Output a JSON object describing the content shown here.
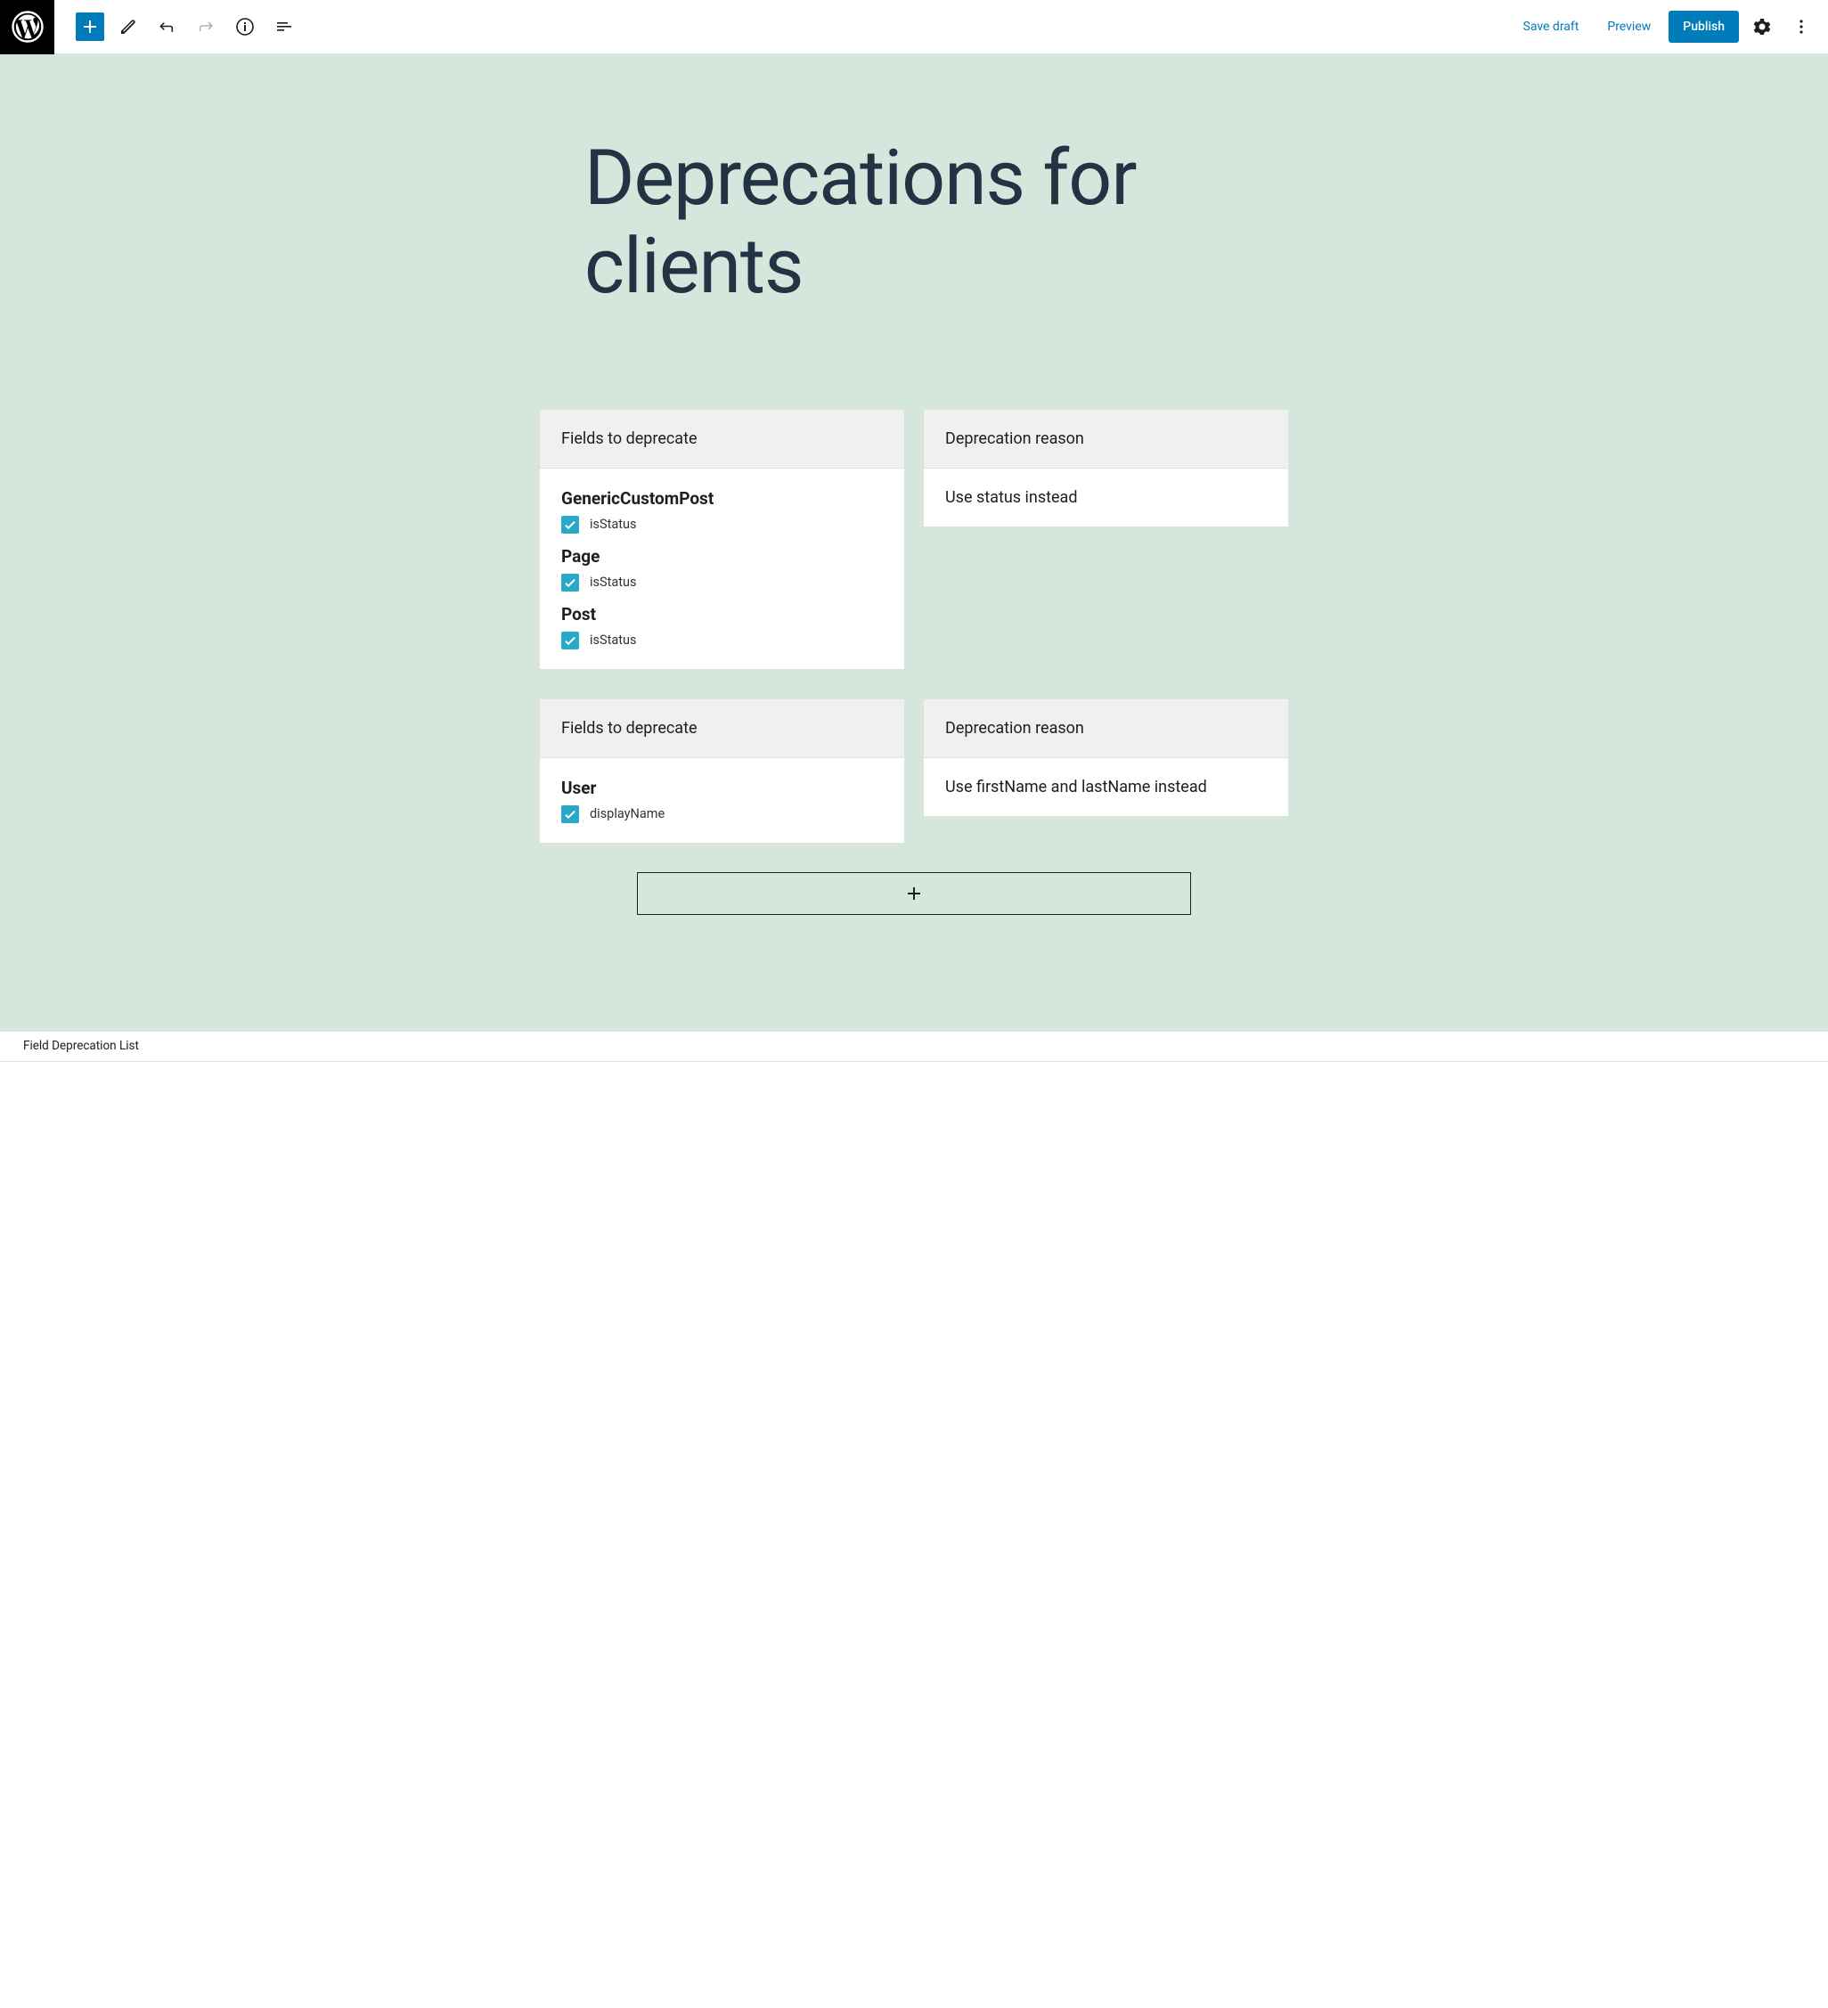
{
  "toolbar": {
    "save_draft": "Save draft",
    "preview": "Preview",
    "publish": "Publish"
  },
  "post": {
    "title": "Deprecations for clients"
  },
  "blocks": [
    {
      "fields_header": "Fields to deprecate",
      "reason_header": "Deprecation reason",
      "reason": "Use status instead",
      "types": [
        {
          "name": "GenericCustomPost",
          "fields": [
            {
              "name": "isStatus",
              "checked": true
            }
          ]
        },
        {
          "name": "Page",
          "fields": [
            {
              "name": "isStatus",
              "checked": true
            }
          ]
        },
        {
          "name": "Post",
          "fields": [
            {
              "name": "isStatus",
              "checked": true
            }
          ]
        }
      ]
    },
    {
      "fields_header": "Fields to deprecate",
      "reason_header": "Deprecation reason",
      "reason": "Use firstName and lastName instead",
      "types": [
        {
          "name": "User",
          "fields": [
            {
              "name": "displayName",
              "checked": true
            }
          ]
        }
      ]
    }
  ],
  "breadcrumb": "Field Deprecation List",
  "colors": {
    "accent": "#007cba",
    "canvas_bg": "#d5e6dd",
    "checkbox": "#2aa8c7",
    "title": "#223344"
  }
}
